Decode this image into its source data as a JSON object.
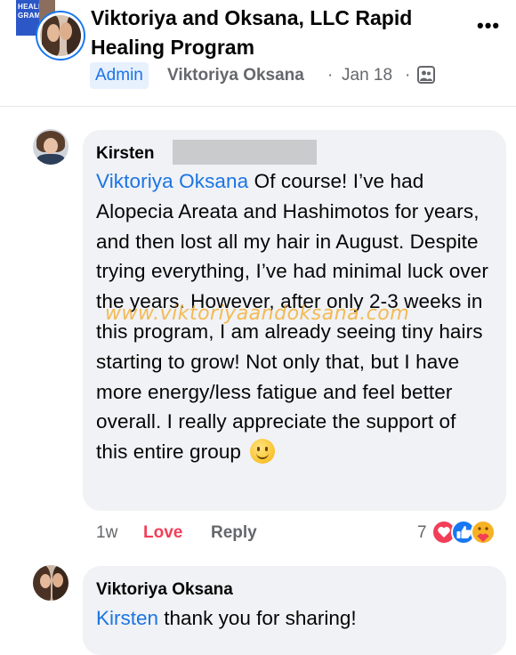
{
  "post": {
    "group_title": "Viktoriya and Oksana, LLC Rapid Healing Program",
    "group_thumb_line1": "HEALING",
    "group_thumb_line2": "GRAM",
    "admin_badge": "Admin",
    "author": "Viktoriya Oksana",
    "separator": "·",
    "date": "Jan 18",
    "more_label": "•••",
    "audience_icon": "members-icon"
  },
  "comments": [
    {
      "name": "Kirsten",
      "mention": "Viktoriya Oksana",
      "text": " Of course! I’ve had Alopecia Areata and Hashimotos for years, and then lost all my hair in August. Despite trying everything, I’ve had minimal luck over the years. However, after only 2-3 weeks in this program, I am already seeing tiny hairs starting to grow! Not only that, but I have more energy/less fatigue and feel better overall. I really appreciate the support of this entire group ",
      "emoji": "smile-emoji",
      "time": "1w",
      "love_label": "Love",
      "reply_label": "Reply",
      "reaction_count": "7",
      "reaction_icons": [
        "heart-icon",
        "like-icon",
        "care-icon"
      ]
    },
    {
      "name": "Viktoriya Oksana",
      "mention": "Kirsten",
      "text": " thank you for sharing!"
    }
  ],
  "watermark": "www.viktoriyaandoksana.com",
  "colors": {
    "accent": "#1b74e4",
    "love": "#f33e58",
    "secondary_text": "#65676b",
    "bubble": "#f0f2f5",
    "watermark": "#f5aa28"
  }
}
